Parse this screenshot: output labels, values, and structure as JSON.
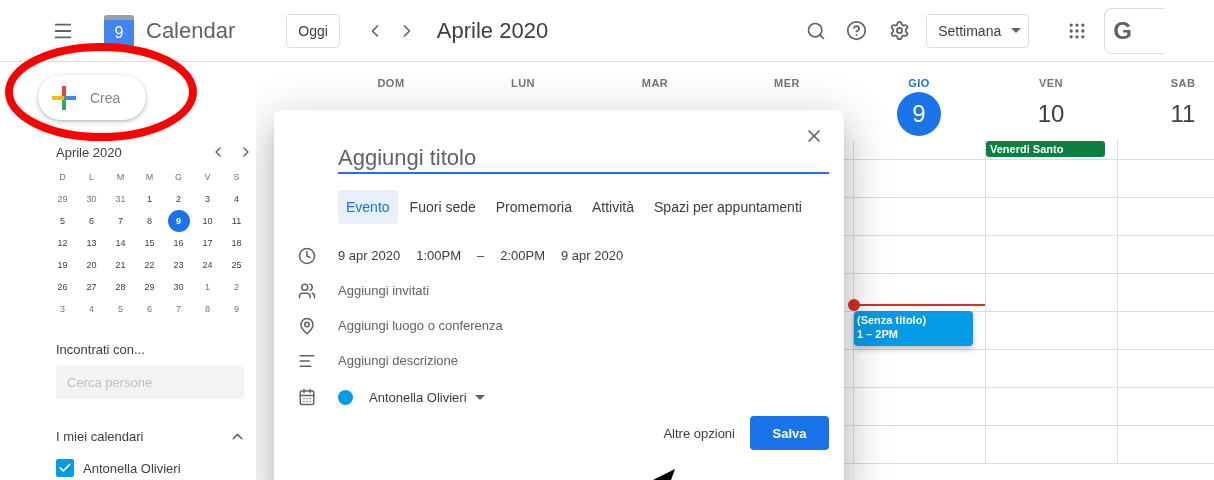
{
  "header": {
    "app_name": "Calendar",
    "logo_day": "9",
    "today_button": "Oggi",
    "period": "Aprile 2020",
    "view_dropdown": "Settimana",
    "account": "G"
  },
  "sidebar": {
    "create_button": "Crea",
    "mini_calendar": {
      "title": "Aprile 2020",
      "weekdays": [
        "D",
        "L",
        "M",
        "M",
        "G",
        "V",
        "S"
      ],
      "weeks": [
        [
          {
            "day": "29",
            "muted": true,
            "selected": false
          },
          {
            "day": "30",
            "muted": true,
            "selected": false
          },
          {
            "day": "31",
            "muted": true,
            "selected": false
          },
          {
            "day": "1",
            "muted": false,
            "selected": false
          },
          {
            "day": "2",
            "muted": false,
            "selected": false
          },
          {
            "day": "3",
            "muted": false,
            "selected": false
          },
          {
            "day": "4",
            "muted": false,
            "selected": false
          }
        ],
        [
          {
            "day": "5",
            "muted": false,
            "selected": false
          },
          {
            "day": "6",
            "muted": false,
            "selected": false
          },
          {
            "day": "7",
            "muted": false,
            "selected": false
          },
          {
            "day": "8",
            "muted": false,
            "selected": false
          },
          {
            "day": "9",
            "muted": false,
            "selected": true
          },
          {
            "day": "10",
            "muted": false,
            "selected": false
          },
          {
            "day": "11",
            "muted": false,
            "selected": false
          }
        ],
        [
          {
            "day": "12",
            "muted": false,
            "selected": false
          },
          {
            "day": "13",
            "muted": false,
            "selected": false
          },
          {
            "day": "14",
            "muted": false,
            "selected": false
          },
          {
            "day": "15",
            "muted": false,
            "selected": false
          },
          {
            "day": "16",
            "muted": false,
            "selected": false
          },
          {
            "day": "17",
            "muted": false,
            "selected": false
          },
          {
            "day": "18",
            "muted": false,
            "selected": false
          }
        ],
        [
          {
            "day": "19",
            "muted": false,
            "selected": false
          },
          {
            "day": "20",
            "muted": false,
            "selected": false
          },
          {
            "day": "21",
            "muted": false,
            "selected": false
          },
          {
            "day": "22",
            "muted": false,
            "selected": false
          },
          {
            "day": "23",
            "muted": false,
            "selected": false
          },
          {
            "day": "24",
            "muted": false,
            "selected": false
          },
          {
            "day": "25",
            "muted": false,
            "selected": false
          }
        ],
        [
          {
            "day": "26",
            "muted": false,
            "selected": false
          },
          {
            "day": "27",
            "muted": false,
            "selected": false
          },
          {
            "day": "28",
            "muted": false,
            "selected": false
          },
          {
            "day": "29",
            "muted": false,
            "selected": false
          },
          {
            "day": "30",
            "muted": false,
            "selected": false
          },
          {
            "day": "1",
            "muted": true,
            "selected": false
          },
          {
            "day": "2",
            "muted": true,
            "selected": false
          }
        ],
        [
          {
            "day": "3",
            "muted": true,
            "selected": false
          },
          {
            "day": "4",
            "muted": true,
            "selected": false
          },
          {
            "day": "5",
            "muted": true,
            "selected": false
          },
          {
            "day": "6",
            "muted": true,
            "selected": false
          },
          {
            "day": "7",
            "muted": true,
            "selected": false
          },
          {
            "day": "8",
            "muted": true,
            "selected": false
          },
          {
            "day": "9",
            "muted": true,
            "selected": false
          }
        ]
      ]
    },
    "people": {
      "heading": "Incontrati con...",
      "placeholder": "Cerca persone"
    },
    "my_calendars": {
      "heading": "I miei calendari",
      "expanded": true,
      "items": [
        {
          "name": "Antonella Olivieri",
          "checked": true,
          "color": "#039be5"
        }
      ]
    }
  },
  "week": {
    "days": [
      {
        "weekday": "DOM",
        "selected": false
      },
      {
        "weekday": "LUN",
        "selected": false
      },
      {
        "weekday": "MAR",
        "selected": false
      },
      {
        "weekday": "MER",
        "selected": false
      },
      {
        "weekday": "GIO",
        "date": "9",
        "selected": true,
        "now_line": true,
        "events": [
          {
            "title": "(Senza titolo)",
            "time": "1 – 2PM"
          }
        ]
      },
      {
        "weekday": "VEN",
        "date": "10",
        "selected": false,
        "all_day": [
          {
            "title": "Venerdi Santo"
          }
        ]
      },
      {
        "weekday": "SAB",
        "date": "11",
        "selected": false
      }
    ]
  },
  "dialog": {
    "title_placeholder": "Aggiungi titolo",
    "tabs": [
      {
        "label": "Evento",
        "selected": true
      },
      {
        "label": "Fuori sede",
        "selected": false
      },
      {
        "label": "Promemoria",
        "selected": false
      },
      {
        "label": "Attività",
        "selected": false
      },
      {
        "label": "Spazi per appuntamenti",
        "selected": false
      }
    ],
    "when": {
      "start_date": "9 apr 2020",
      "start_time": "1:00PM",
      "separator": "–",
      "end_time": "2:00PM",
      "end_date": "9 apr 2020"
    },
    "rows": [
      {
        "kind": "guests",
        "text": "Aggiungi invitati"
      },
      {
        "kind": "location",
        "text": "Aggiungi luogo o conferenza"
      },
      {
        "kind": "description",
        "text": "Aggiungi descrizione"
      }
    ],
    "calendar": {
      "name": "Antonella Olivieri",
      "color": "#039be5"
    },
    "more_options": "Altre opzioni",
    "save": "Salva"
  }
}
